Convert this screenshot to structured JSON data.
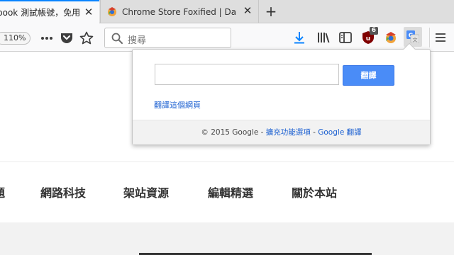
{
  "tabs": [
    {
      "title": "book 測試帳號，免用ш",
      "close": "✕"
    },
    {
      "title": "Chrome Store Foxified | Dashbo",
      "close": "✕"
    }
  ],
  "new_tab": "+",
  "toolbar": {
    "zoom": "110%",
    "search_placeholder": "搜尋",
    "ublock_badge": "6",
    "extension_badge_color": "#9a9a9a"
  },
  "popup": {
    "translate_button": "翻譯",
    "translate_page_link": "翻譯這個網頁",
    "footer": {
      "copyright": "© 2015 Google",
      "sep1": " - ",
      "options_link": "擴充功能選項",
      "sep2": " - ",
      "translate_link": "Google 翻譯"
    }
  },
  "nav": {
    "items": [
      "題",
      "網路科技",
      "架站資源",
      "編輯精選",
      "關於本站"
    ]
  },
  "colors": {
    "tab_accent": "#0a84ff",
    "download_icon": "#0a84ff",
    "translate_button": "#4a8cf7",
    "link": "#1a5fd1"
  }
}
